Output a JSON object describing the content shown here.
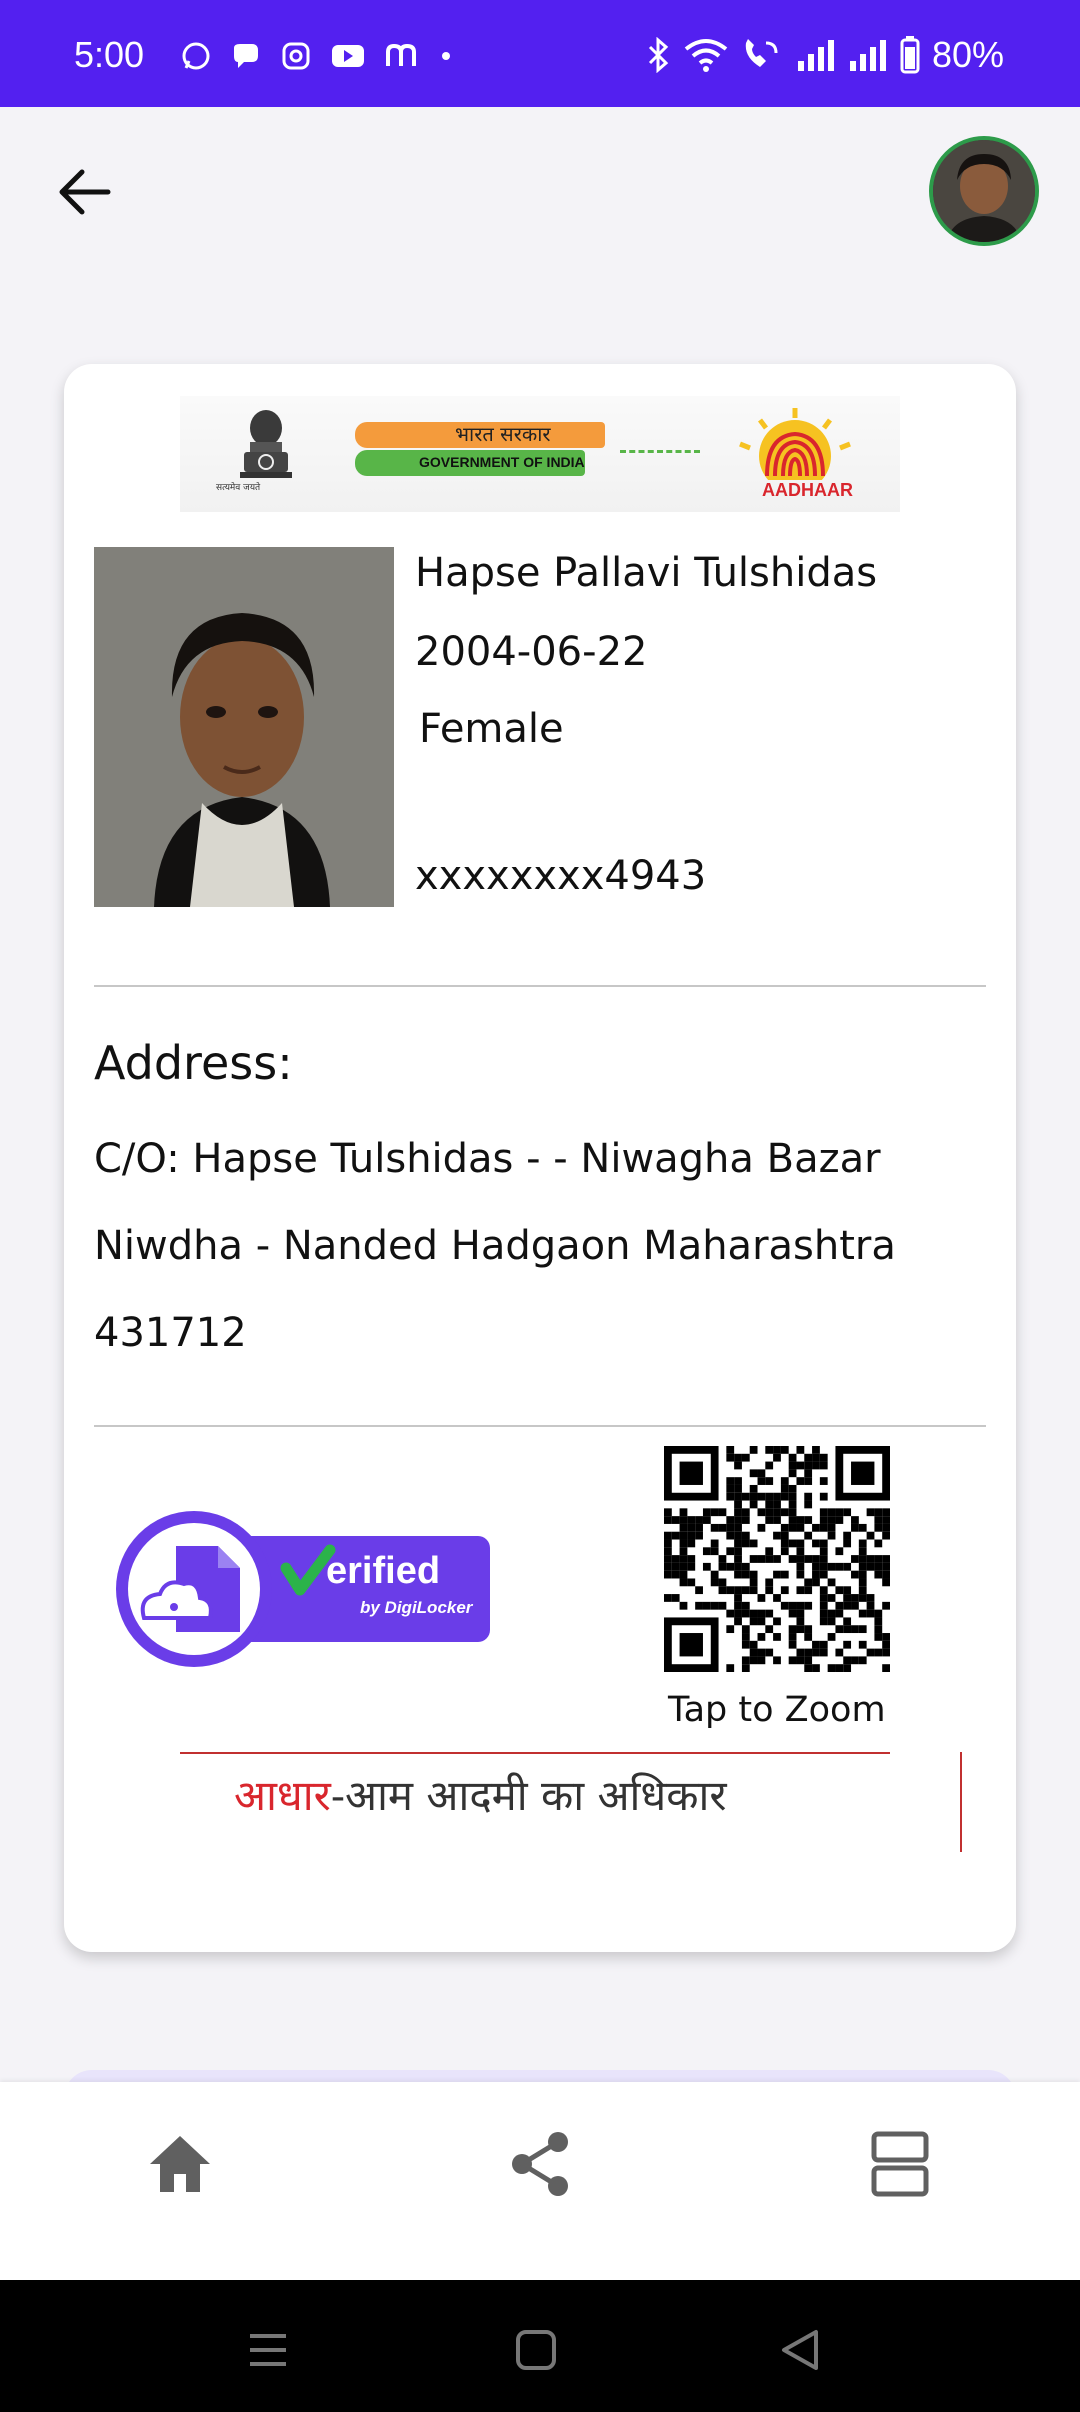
{
  "status_bar": {
    "time": "5:00",
    "left_icons": [
      "whatsapp-icon",
      "chat-icon",
      "instagram-icon",
      "youtube-icon",
      "m-app-icon",
      "dot-icon"
    ],
    "right_icons": [
      "bluetooth-icon",
      "wifi-icon",
      "wifi-call-icon",
      "signal-icon",
      "signal-icon",
      "battery-icon"
    ],
    "battery": "80%",
    "background": "#5320f0"
  },
  "header": {
    "back_icon": "arrow-left-icon",
    "avatar_icon": "profile-avatar"
  },
  "card": {
    "banner": {
      "hindi": "भारत सरकार",
      "english": "GOVERNMENT OF INDIA",
      "brand": "AADHAAR",
      "emblem_caption": "सत्यमेव जयते"
    },
    "name": "Hapse Pallavi Tulshidas",
    "dob": "2004-06-22",
    "gender": "Female",
    "uid": "xxxxxxxx4943",
    "address_title": "Address:",
    "address": "C/O: Hapse Tulshidas - - Niwagha Bazar Niwdha - Nanded Hadgaon Maharashtra 431712",
    "verified": {
      "label": "erified",
      "by": "by DigiLocker"
    },
    "tap_to_zoom": "Tap to Zoom",
    "slogan_red": "आधार",
    "slogan_rest": "-आम आदमी का अधिकार"
  },
  "bottom_nav": {
    "items": [
      {
        "icon": "home-icon"
      },
      {
        "icon": "share-icon"
      },
      {
        "icon": "menu-list-icon"
      }
    ]
  },
  "colors": {
    "accent": "#5320f0",
    "badge": "#6a3de8",
    "check_green": "#2bb34a",
    "slogan_red": "#d9262d"
  }
}
